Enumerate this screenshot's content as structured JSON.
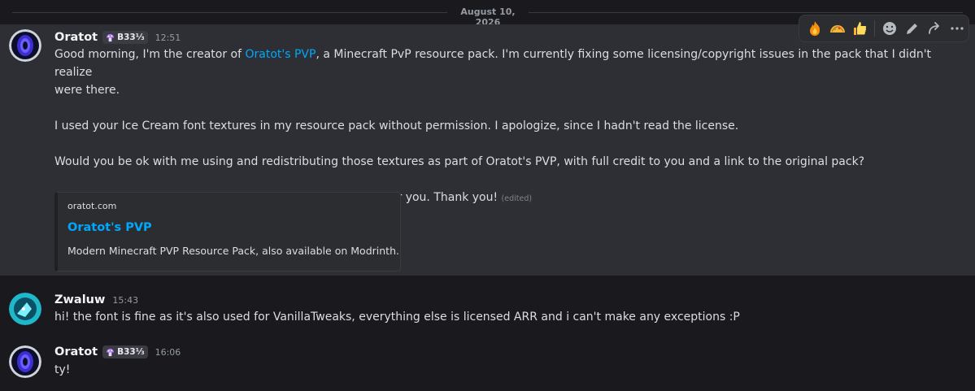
{
  "date_divider": "August 10, 2026",
  "messages": [
    {
      "author": "Oratot",
      "tag": "B33⅓",
      "time": "12:51",
      "line1_a": "Good morning, I'm the creator of ",
      "line1_link": "Oratot's PVP",
      "line1_b": ", a Minecraft PvP resource pack. I'm currently fixing some licensing/copyright issues in the pack that I didn't realize",
      "line2": "were there.",
      "para2": "I used your Ice Cream font textures in my resource pack without permission. I apologize, since I hadn't read the license.",
      "para3": "Would you be ok with me using and redistributing those textures as part of Oratot's PVP, with full credit to you and a link to the original pack?",
      "para4": "Sorry for using them without asking first, and sorry to bother you. Thank you!",
      "edited": "(edited)",
      "embed": {
        "provider": "oratot.com",
        "title": "Oratot's PVP",
        "description": "Modern Minecraft PVP Resource Pack, also available on Modrinth."
      }
    },
    {
      "author": "Zwaluw",
      "time": "15:43",
      "text": "hi! the font is fine as it's also used for VanillaTweaks, everything else is licensed ARR and i can't make any exceptions :P"
    },
    {
      "author": "Oratot",
      "tag": "B33⅓",
      "time": "16:06",
      "text": "ty!"
    }
  ],
  "toolbar": {
    "reactions": [
      "fire-emoji",
      "taco-emoji",
      "thumbs-up-emoji"
    ],
    "actions": [
      "add-reaction-icon",
      "edit-icon",
      "reply-icon",
      "more-icon"
    ]
  },
  "colors": {
    "link": "#00a8fc",
    "hover_bg": "#2e2f34",
    "bg": "#1a1a1e"
  }
}
